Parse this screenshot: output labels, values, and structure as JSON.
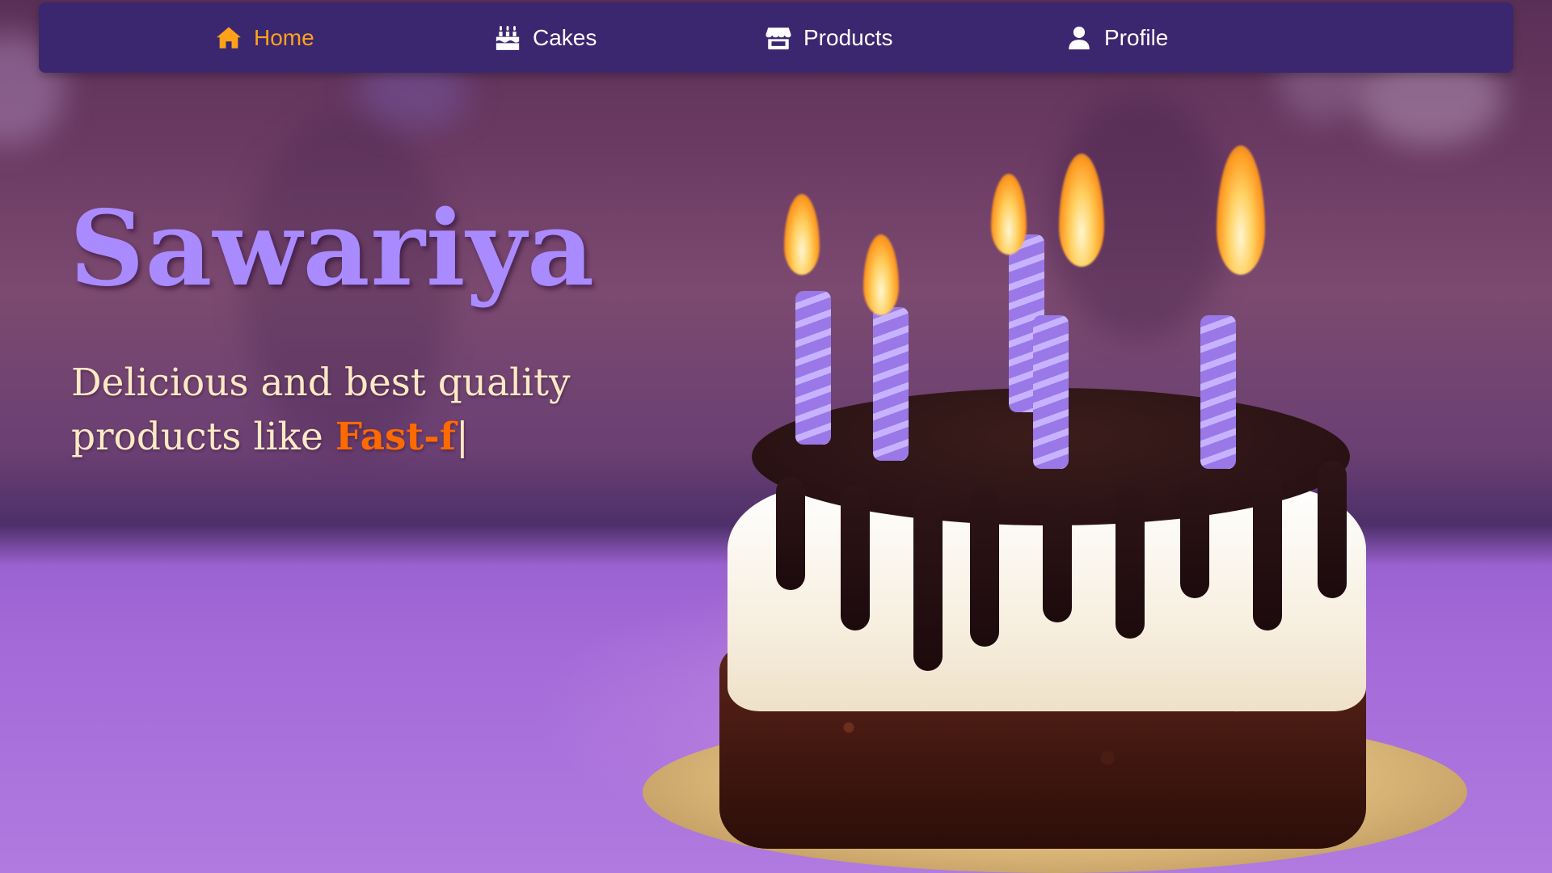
{
  "nav": {
    "items": [
      {
        "label": "Home",
        "icon": "home-icon",
        "active": true
      },
      {
        "label": "Cakes",
        "icon": "cake-icon",
        "active": false
      },
      {
        "label": "Products",
        "icon": "store-icon",
        "active": false
      },
      {
        "label": "Profile",
        "icon": "user-icon",
        "active": false
      }
    ]
  },
  "hero": {
    "brand": "Sawariya",
    "tagline_prefix": "Delicious and best quality products like ",
    "typed_text": "Fast-f",
    "cursor": "|"
  },
  "colors": {
    "navbar": "#3b2670",
    "active_nav": "#ffa21a",
    "brand": "#a98bff",
    "tagline": "#fde9c4",
    "typed": "#ff6a00"
  }
}
